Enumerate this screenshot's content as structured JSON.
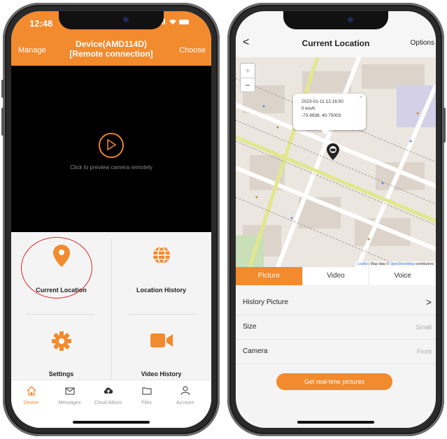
{
  "left_phone": {
    "status_bar": {
      "time": "12:48",
      "icons": "signal wifi battery"
    },
    "header": {
      "manage_label": "Manage",
      "title_line1": "Device(AMD114D)",
      "title_line2": "[Remote connection]",
      "choose_label": "Choose"
    },
    "preview": {
      "hint": "Click to preview camera remotely"
    },
    "features": [
      {
        "label": "Current Location",
        "icon": "location-pin-icon"
      },
      {
        "label": "Location History",
        "icon": "globe-icon"
      },
      {
        "label": "Settings",
        "icon": "gear-icon"
      },
      {
        "label": "Video History",
        "icon": "video-camera-icon"
      }
    ],
    "tabs": [
      {
        "label": "Device",
        "icon": "home-icon",
        "active": true
      },
      {
        "label": "Messages",
        "icon": "mail-icon",
        "active": false
      },
      {
        "label": "Cloud Album",
        "icon": "cloud-icon",
        "active": false
      },
      {
        "label": "Files",
        "icon": "folder-icon",
        "active": false
      },
      {
        "label": "Account",
        "icon": "person-icon",
        "active": false
      }
    ],
    "colors": {
      "accent": "#f28a2e",
      "highlight_circle": "#e0262a"
    }
  },
  "right_phone": {
    "header": {
      "back_label": "<",
      "title": "Current Location",
      "options_label": "Options"
    },
    "map": {
      "zoom_in": "+",
      "zoom_out": "−",
      "popup_line1": "2023-01-11 12:16:50",
      "popup_line2": "0 km/h",
      "popup_line3": "-73.9938, 40.75003",
      "popup_close": "×",
      "attribution_leaflet": "Leaflet",
      "attribution_mid": " | Map data © ",
      "attribution_osm": "OpenStreetMap",
      "attribution_end": " contributors"
    },
    "segments": [
      {
        "label": "Picture",
        "active": true
      },
      {
        "label": "Video",
        "active": false
      },
      {
        "label": "Voice",
        "active": false
      }
    ],
    "rows": [
      {
        "key": "History Picture",
        "value": ">"
      },
      {
        "key": "Size",
        "value": "Small"
      },
      {
        "key": "Camera",
        "value": "Front"
      }
    ],
    "button_label": "Get real-time pictures"
  }
}
